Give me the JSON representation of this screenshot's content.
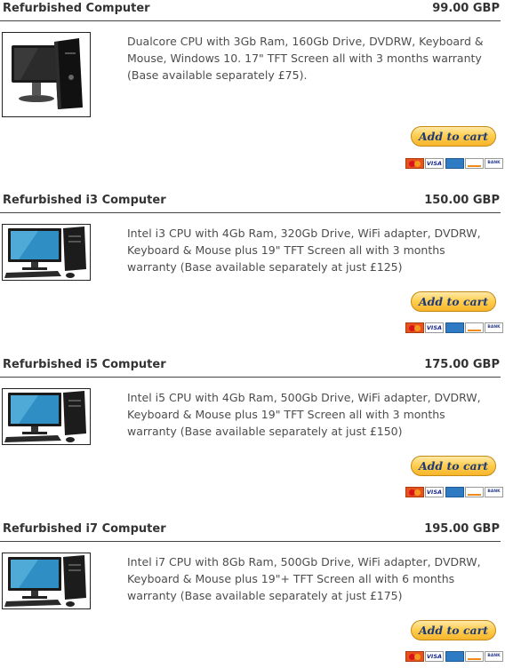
{
  "products": [
    {
      "title": "Refurbished Computer",
      "price": "99.00 GBP",
      "description": "Dualcore CPU with 3Gb Ram, 160Gb Drive, DVDRW, Keyboard & Mouse, Windows 10. 17\" TFT Screen all with 3 months warranty (Base available separately £75).",
      "add_to_cart_label": "Add to cart",
      "image_icon": "monitor-tower-icon"
    },
    {
      "title": "Refurbished i3 Computer",
      "price": "150.00 GBP",
      "description": "Intel i3 CPU with 4Gb Ram, 320Gb Drive, WiFi adapter, DVDRW, Keyboard & Mouse plus 19\" TFT Screen all with 3 months warranty (Base available separately at just £125)",
      "add_to_cart_label": "Add to cart",
      "image_icon": "desktop-set-icon"
    },
    {
      "title": "Refurbished i5 Computer",
      "price": "175.00 GBP",
      "description": "Intel i5 CPU with 4Gb Ram, 500Gb Drive, WiFi adapter, DVDRW, Keyboard & Mouse plus 19\" TFT Screen all with 3 months warranty (Base available separately at just £150)",
      "add_to_cart_label": "Add to cart",
      "image_icon": "desktop-set-icon"
    },
    {
      "title": "Refurbished i7 Computer",
      "price": "195.00 GBP",
      "description": "Intel i7 CPU with 8Gb Ram, 500Gb Drive, WiFi adapter, DVDRW, Keyboard & Mouse plus 19\"+ TFT Screen all with 6 months warranty (Base available separately at just £175)",
      "add_to_cart_label": "Add to cart",
      "image_icon": "desktop-set-icon"
    }
  ],
  "payment_cards": {
    "mastercard": "",
    "visa": "VISA",
    "amex": "",
    "discover": "",
    "bank": "BANK"
  },
  "colors": {
    "button_gold": "#ffcf52",
    "button_text": "#1d3a7a",
    "rule": "#444444"
  }
}
